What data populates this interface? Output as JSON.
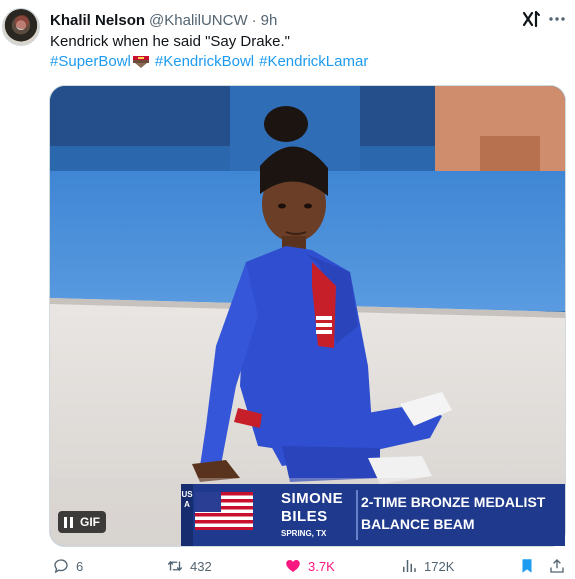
{
  "author": {
    "name": "Khalil Nelson",
    "handle": "@KhalilUNCW",
    "separator": "·",
    "time": "9h"
  },
  "tweet": {
    "text": "Kendrick when he said \"Say Drake.\"",
    "hashtags": [
      "#SuperBowl",
      "#KendrickBowl",
      "#KendrickLamar"
    ]
  },
  "media": {
    "badge": "GIF",
    "lower_third": {
      "first_name": "SIMONE",
      "last_name": "BILES",
      "hometown": "SPRING, TX",
      "country": "USA",
      "title_line1": "2-TIME BRONZE MEDALIST",
      "title_line2": "BALANCE BEAM"
    }
  },
  "actions": {
    "replies": "6",
    "reposts": "432",
    "likes": "3.7K",
    "views": "172K"
  },
  "colors": {
    "link": "#1d9bf0",
    "like": "#f91880",
    "muted": "#536471",
    "bookmark": "#1d9bf0",
    "jacket": "#2f4fd0"
  },
  "icons": [
    "grok-icon",
    "more-icon",
    "super-bowl-logo-icon",
    "pause-icon",
    "reply-icon",
    "repost-icon",
    "like-icon",
    "views-icon",
    "bookmark-icon",
    "share-icon"
  ]
}
